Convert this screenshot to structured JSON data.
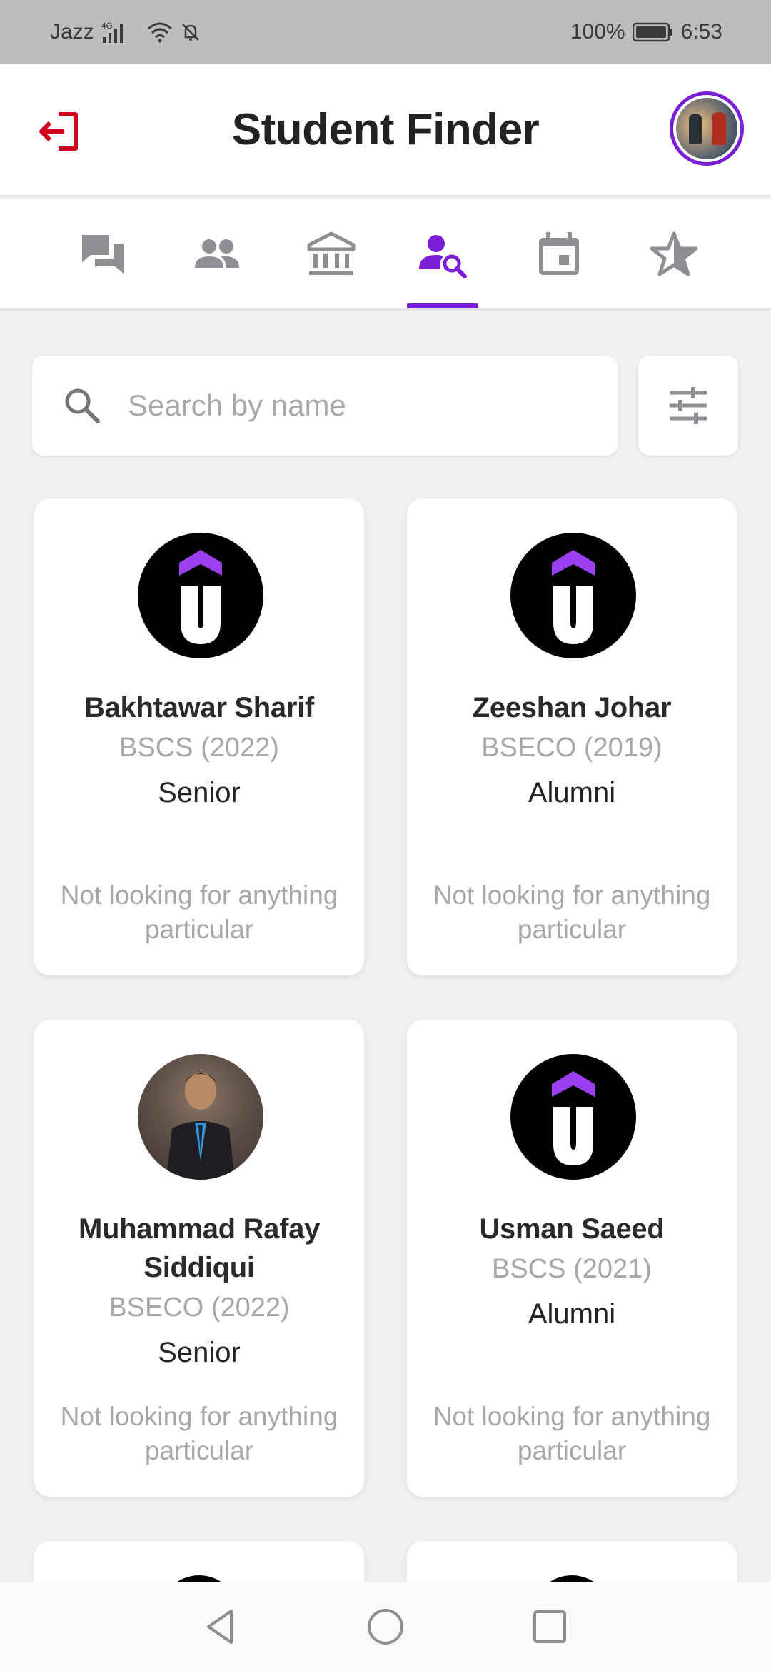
{
  "status_bar": {
    "carrier": "Jazz",
    "network": "4G",
    "battery": "100%",
    "time": "6:53"
  },
  "header": {
    "title": "Student Finder",
    "logout_icon": "logout-icon",
    "avatar": "profile-avatar"
  },
  "tabs": [
    {
      "name": "chat",
      "icon": "chat-icon",
      "active": false
    },
    {
      "name": "people",
      "icon": "people-icon",
      "active": false
    },
    {
      "name": "institution",
      "icon": "bank-icon",
      "active": false
    },
    {
      "name": "student-finder",
      "icon": "person-search-icon",
      "active": true
    },
    {
      "name": "events",
      "icon": "calendar-icon",
      "active": false
    },
    {
      "name": "favorites",
      "icon": "star-icon",
      "active": false
    }
  ],
  "search": {
    "placeholder": "Search by name",
    "value": ""
  },
  "students": [
    {
      "name": "Bakhtawar Sharif",
      "program": "BSCS (2022)",
      "status": "Senior",
      "looking": "Not looking for anything particular",
      "avatar": "logo"
    },
    {
      "name": "Zeeshan Johar",
      "program": "BSECO (2019)",
      "status": "Alumni",
      "looking": "Not looking for anything particular",
      "avatar": "logo"
    },
    {
      "name": "Muhammad Rafay Siddiqui",
      "program": "BSECO (2022)",
      "status": "Senior",
      "looking": "Not looking for anything particular",
      "avatar": "photo"
    },
    {
      "name": "Usman Saeed",
      "program": "BSCS (2021)",
      "status": "Alumni",
      "looking": "Not looking for anything particular",
      "avatar": "logo"
    }
  ],
  "colors": {
    "accent": "#7a1fd6",
    "logout": "#d0021b",
    "icon_inactive": "#8e8e93"
  }
}
